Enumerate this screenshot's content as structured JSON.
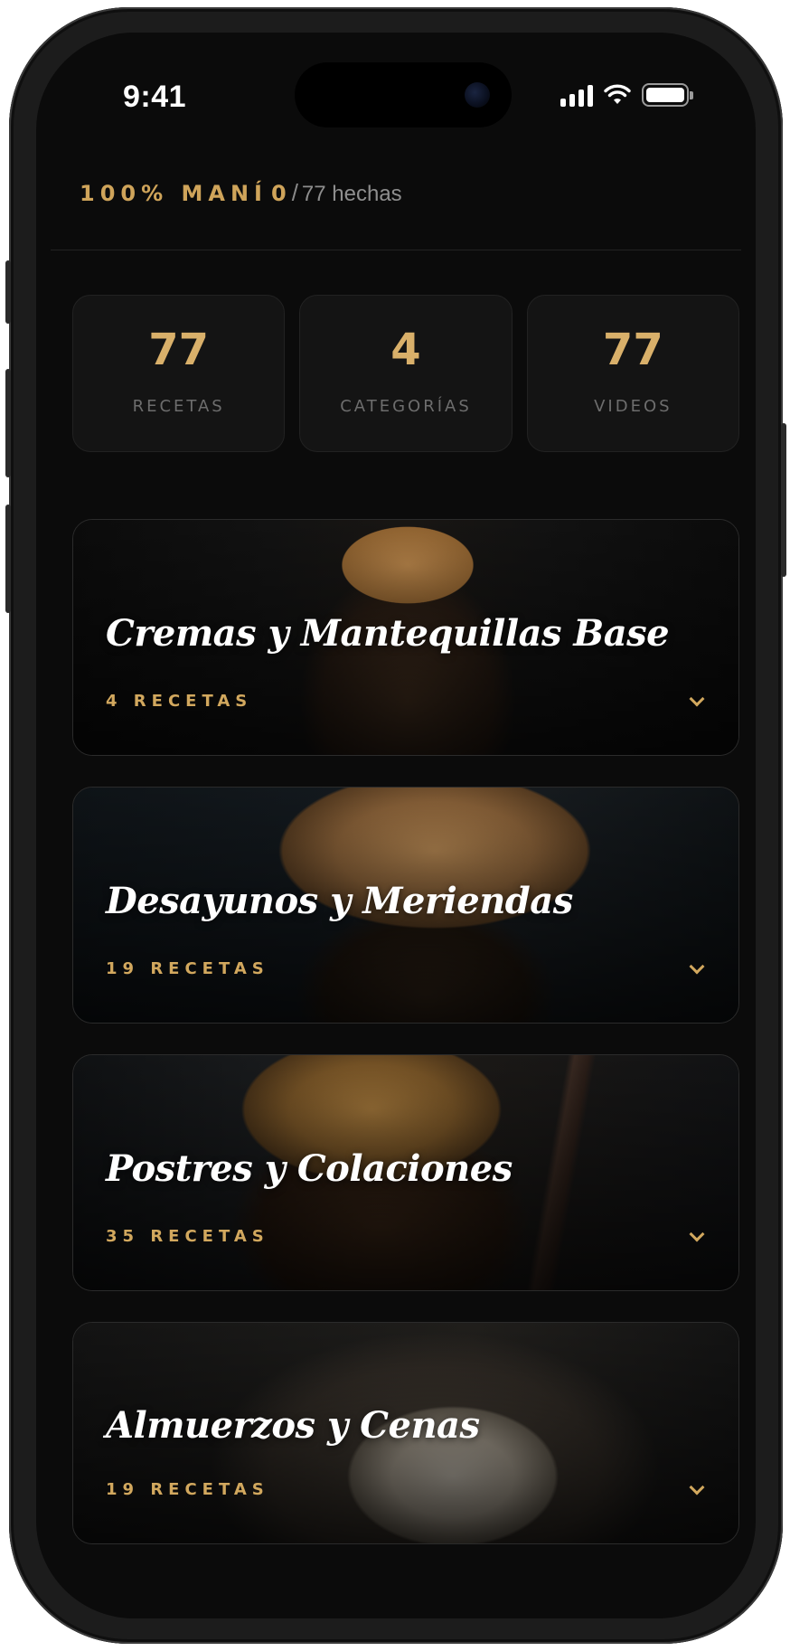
{
  "status_bar": {
    "time": "9:41"
  },
  "header": {
    "brand": "100% MANÍ",
    "done_count": "0",
    "separator": "/",
    "total_text": "77 hechas"
  },
  "stats": [
    {
      "value": "77",
      "label": "RECETAS"
    },
    {
      "value": "4",
      "label": "CATEGORÍAS"
    },
    {
      "value": "77",
      "label": "VIDEOS"
    }
  ],
  "categories": [
    {
      "title": "Cremas y Mantequillas Base",
      "count": "4 RECETAS",
      "image": "peanut-butter-jar"
    },
    {
      "title": "Desayunos y Meriendas",
      "count": "19 RECETAS",
      "image": "muffin"
    },
    {
      "title": "Postres y Colaciones",
      "count": "35 RECETAS",
      "image": "dessert-bar"
    },
    {
      "title": "Almuerzos y Cenas",
      "count": "19 RECETAS",
      "image": "rice-plate"
    }
  ],
  "theme": {
    "accent": "#cfa45a",
    "background": "#0b0b0b",
    "card": "#141414"
  }
}
